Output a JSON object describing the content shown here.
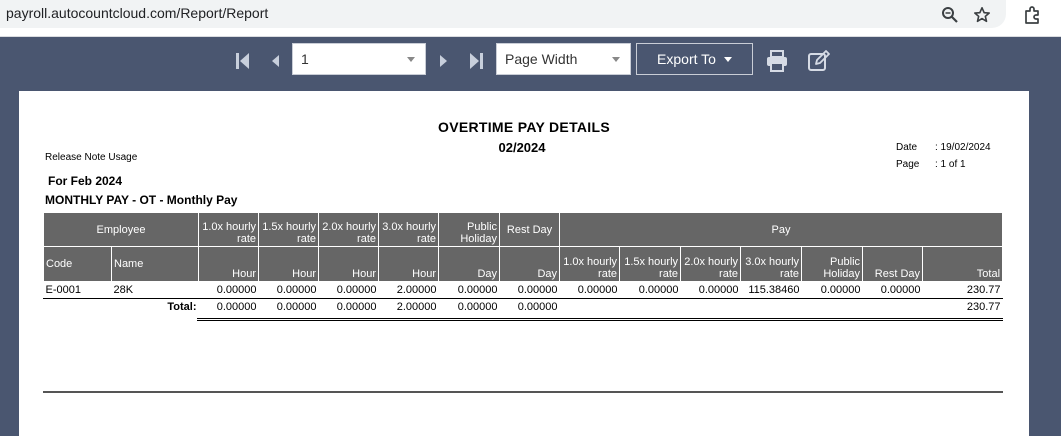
{
  "browser": {
    "url": "payroll.autocountcloud.com/Report/Report"
  },
  "toolbar": {
    "page_number": "1",
    "zoom": "Page Width",
    "export_label": "Export To"
  },
  "report": {
    "title": "OVERTIME PAY DETAILS",
    "period": "02/2024",
    "release_note": "Release Note Usage",
    "for_label": "For Feb 2024",
    "section": "MONTHLY PAY - OT - Monthly Pay",
    "date_label": "Date",
    "date_value": ": 19/02/2024",
    "page_label": "Page",
    "page_value": ": 1 of 1",
    "headers_top": {
      "employee": "Employee",
      "h10": "1.0x hourly rate",
      "h15": "1.5x hourly rate",
      "h20": "2.0x hourly rate",
      "h30": "3.0x hourly rate",
      "public_holiday": "Public Holiday",
      "rest_day": "Rest Day",
      "pay": "Pay"
    },
    "headers_sub": {
      "code": "Code",
      "name": "Name",
      "hour": "Hour",
      "day": "Day",
      "p10": "1.0x hourly rate",
      "p15": "1.5x hourly rate",
      "p20": "2.0x hourly rate",
      "p30": "3.0x hourly rate",
      "public_holiday": "Public Holiday",
      "rest_day": "Rest Day",
      "total": "Total"
    },
    "row": {
      "code": "E-0001",
      "name": "28K",
      "h10": "0.00000",
      "h15": "0.00000",
      "h20": "0.00000",
      "h30": "2.00000",
      "ph": "0.00000",
      "rd": "0.00000",
      "p10": "0.00000",
      "p15": "0.00000",
      "p20": "0.00000",
      "p30": "115.38460",
      "pph": "0.00000",
      "prd": "0.00000",
      "total": "230.77"
    },
    "totals": {
      "label": "Total:",
      "h10": "0.00000",
      "h15": "0.00000",
      "h20": "0.00000",
      "h30": "2.00000",
      "ph": "0.00000",
      "rd": "0.00000",
      "total": "230.77"
    }
  }
}
